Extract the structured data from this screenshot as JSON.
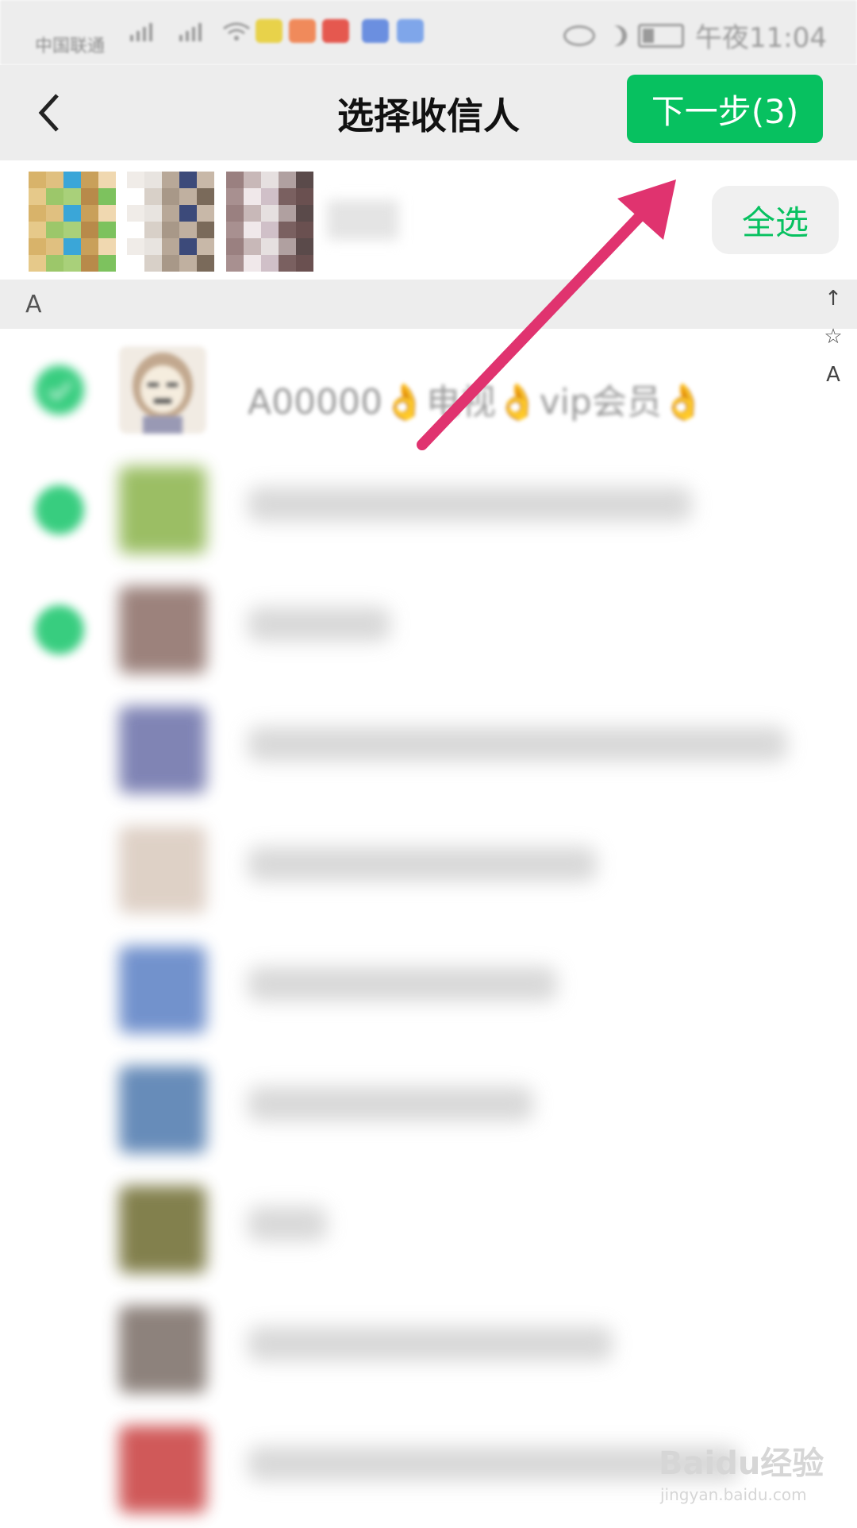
{
  "status_bar": {
    "carrier": "中国联通",
    "time": "午夜11:04"
  },
  "header": {
    "title": "选择收信人",
    "next_label": "下一步(3)"
  },
  "selection": {
    "select_all_label": "全选",
    "selected_count": 3
  },
  "list": {
    "section_letter": "A",
    "first_contact_name": "A00000👌电视👌vip会员👌",
    "rows": [
      {
        "checked": true,
        "avatar_color": "#c7b28f",
        "name_width": 0
      },
      {
        "checked": true,
        "avatar_color": "#8ab34a",
        "name_width": 560
      },
      {
        "checked": true,
        "avatar_color": "#8b6d66",
        "name_width": 180
      },
      {
        "checked": false,
        "avatar_color": "#6a6fa8",
        "name_width": 680
      },
      {
        "checked": false,
        "avatar_color": "#d9c9bd",
        "name_width": 440
      },
      {
        "checked": false,
        "avatar_color": "#5a7fc4",
        "name_width": 390
      },
      {
        "checked": false,
        "avatar_color": "#4d78ad",
        "name_width": 360
      },
      {
        "checked": false,
        "avatar_color": "#6d6a2e",
        "name_width": 100
      },
      {
        "checked": false,
        "avatar_color": "#7a6d66",
        "name_width": 460
      },
      {
        "checked": false,
        "avatar_color": "#c83d3d",
        "name_width": 620
      }
    ]
  },
  "alpha_index": [
    "↑",
    "☆",
    "A"
  ],
  "colors": {
    "accent": "#07c160",
    "annotation_arrow": "#e0336f"
  },
  "watermark": {
    "brand": "Baidu经验",
    "url": "jingyan.baidu.com"
  }
}
